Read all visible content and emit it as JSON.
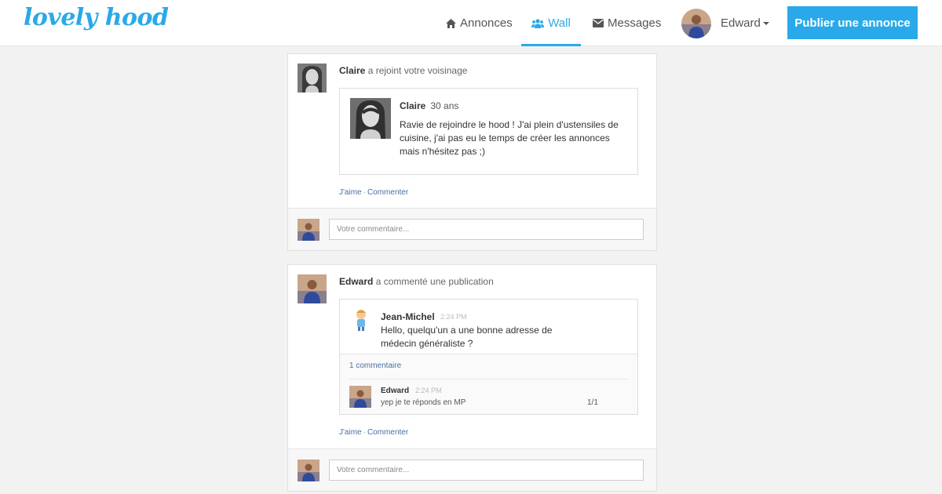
{
  "brand": {
    "logo_text": "lovely hood",
    "accent": "#29a9e9"
  },
  "nav": {
    "items": [
      {
        "label": "Annonces",
        "icon": "home-icon"
      },
      {
        "label": "Wall",
        "icon": "users-icon",
        "active": true
      },
      {
        "label": "Messages",
        "icon": "envelope-icon"
      }
    ],
    "user_name": "Edward",
    "publish_label": "Publier une annonce"
  },
  "feed": [
    {
      "actor": "Claire",
      "action": "a rejoint votre voisinage",
      "profile": {
        "name": "Claire",
        "age": "30 ans",
        "message": "Ravie de rejoindre le hood ! J'ai plein d'ustensiles de cuisine, j'ai pas eu le temps de créer les annonces mais n'hésitez pas ;)"
      },
      "like_label": "J'aime",
      "comment_label": "Commenter",
      "input_placeholder": "Votre commentaire..."
    },
    {
      "actor": "Edward",
      "action": "a commenté une publication",
      "post": {
        "author": "Jean-Michel",
        "time": "2:24 PM",
        "message": "Hello, quelqu'un a une bonne adresse de médecin généraliste ?",
        "comments_count_label": "1 commentaire",
        "comment": {
          "author": "Edward",
          "time": "2:24 PM",
          "text": "yep je te réponds en MP",
          "page": "1/1"
        }
      },
      "like_label": "J'aime",
      "comment_label": "Commenter",
      "input_placeholder": "Votre commentaire..."
    }
  ]
}
